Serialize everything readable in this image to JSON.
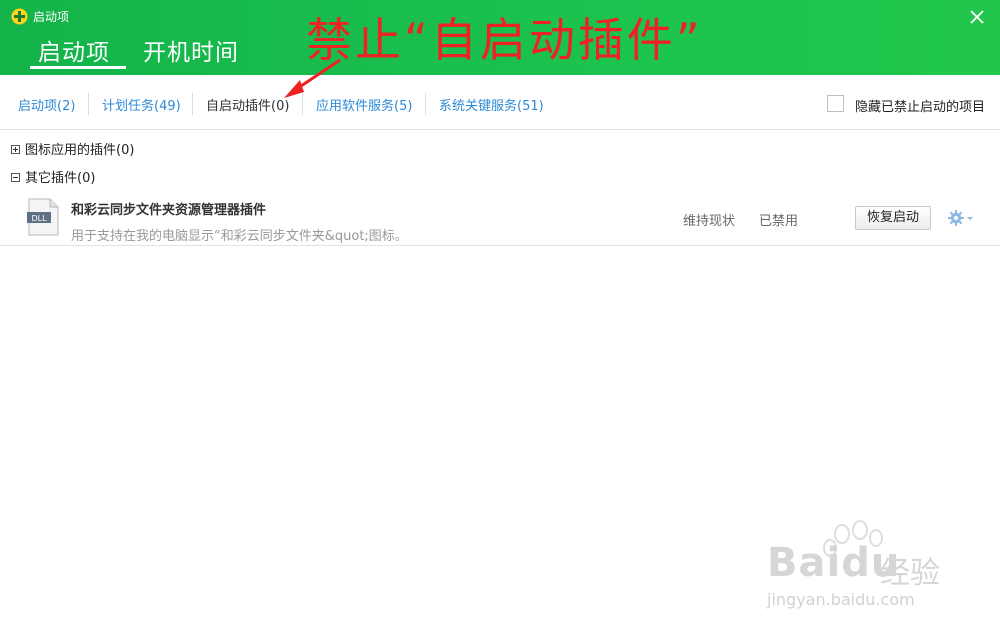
{
  "window": {
    "title": "启动项",
    "header_tabs": [
      {
        "label": "启动项",
        "active": true
      },
      {
        "label": "开机时间",
        "active": false
      }
    ]
  },
  "annotation": {
    "text": "禁止“自启动插件”",
    "color": "#ee2222"
  },
  "subtabs": [
    {
      "label": "启动项(2)",
      "active": false
    },
    {
      "label": "计划任务(49)",
      "active": false
    },
    {
      "label": "自启动插件(0)",
      "active": true
    },
    {
      "label": "应用软件服务(5)",
      "active": false
    },
    {
      "label": "系统关键服务(51)",
      "active": false
    }
  ],
  "hide_disabled_label": "隐藏已禁止启动的项目",
  "groups": [
    {
      "label": "图标应用的插件(0)",
      "expanded": false
    },
    {
      "label": "其它插件(0)",
      "expanded": true
    }
  ],
  "item": {
    "icon": "dll-file-icon",
    "icon_text": "DLL",
    "name": "和彩云同步文件夹资源管理器插件",
    "description": "用于支持在我的电脑显示“和彩云同步文件夹&quot;图标。",
    "suggestion": "维持现状",
    "status": "已禁用",
    "action_label": "恢复启动"
  },
  "watermark": {
    "brand": "Bai",
    "brand2": "du",
    "cn": "经验",
    "url": "jingyan.baidu.com"
  },
  "colors": {
    "header_green": "#1cc34e",
    "link_blue": "#2e8ad8",
    "annotation_red": "#ee2222"
  }
}
